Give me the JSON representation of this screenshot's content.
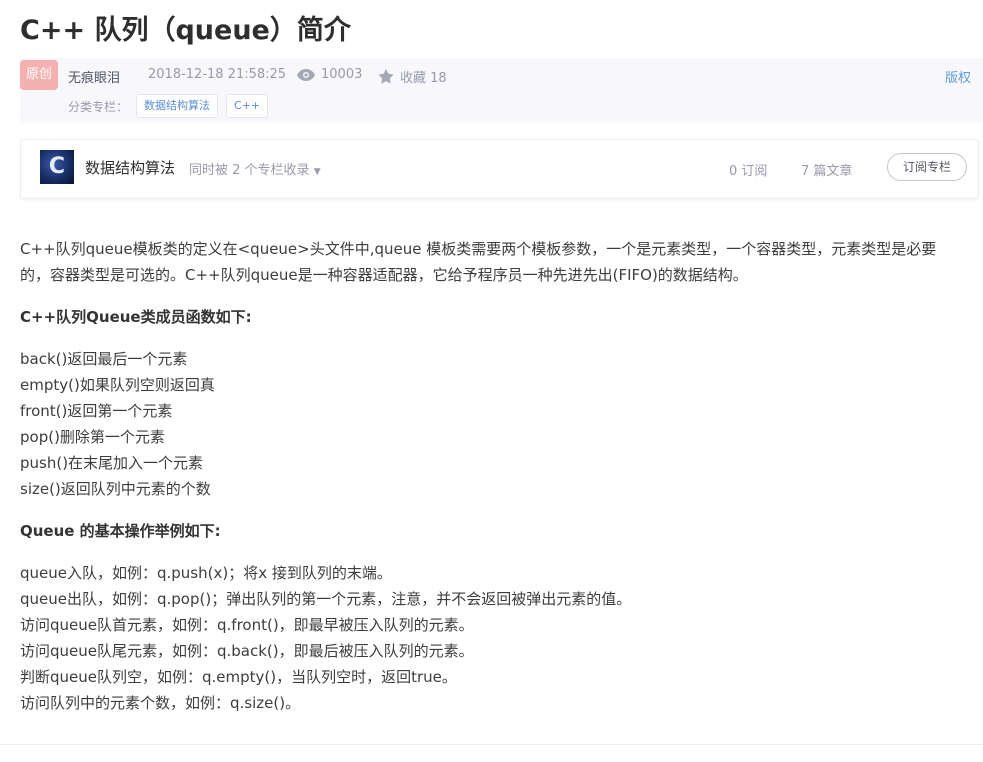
{
  "article": {
    "title": "C++ 队列（queue）简介",
    "badge": "原创",
    "author": "无痕眼泪",
    "date": "2018-12-18 21:58:25",
    "views": "10003",
    "favorites": "收藏 18",
    "copyright": "版权",
    "category_label": "分类专栏：",
    "tags": [
      "数据结构算法",
      "C++"
    ]
  },
  "column": {
    "logo_letter": "C",
    "name": "数据结构算法",
    "extra": "同时被 2 个专栏收录",
    "subscriptions": "0 订阅",
    "articles": "7 篇文章",
    "subscribe_label": "订阅专栏"
  },
  "content": {
    "intro_line1": "C++队列queue模板类的定义在<queue>头文件中,queue 模板类需要两个模板参数，一个是元素类型，一个容器类型，元素类型是必要",
    "intro_line2": "的，容器类型是可选的。C++队列queue是一种容器适配器，它给予程序员一种先进先出(FIFO)的数据结构。",
    "heading1": "C++队列Queue类成员函数如下:",
    "functions": [
      "back()返回最后一个元素",
      "empty()如果队列空则返回真",
      "front()返回第一个元素",
      "pop()删除第一个元素",
      "push()在末尾加入一个元素",
      "size()返回队列中元素的个数"
    ],
    "heading2": "Queue 的基本操作举例如下:",
    "examples": [
      "queue入队，如例：q.push(x)；将x 接到队列的末端。",
      "queue出队，如例：q.pop()；弹出队列的第一个元素，注意，并不会返回被弹出元素的值。",
      "访问queue队首元素，如例：q.front()，即最早被压入队列的元素。",
      "访问queue队尾元素，如例：q.back()，即最后被压入队列的元素。",
      "判断queue队列空，如例：q.empty()，当队列空时，返回true。",
      "访问队列中的元素个数，如例：q.size()。"
    ]
  },
  "colors": {
    "badge_bg": "#f4b1b0",
    "link": "#5d8cd0",
    "meta_bg": "#f7f7fc"
  }
}
